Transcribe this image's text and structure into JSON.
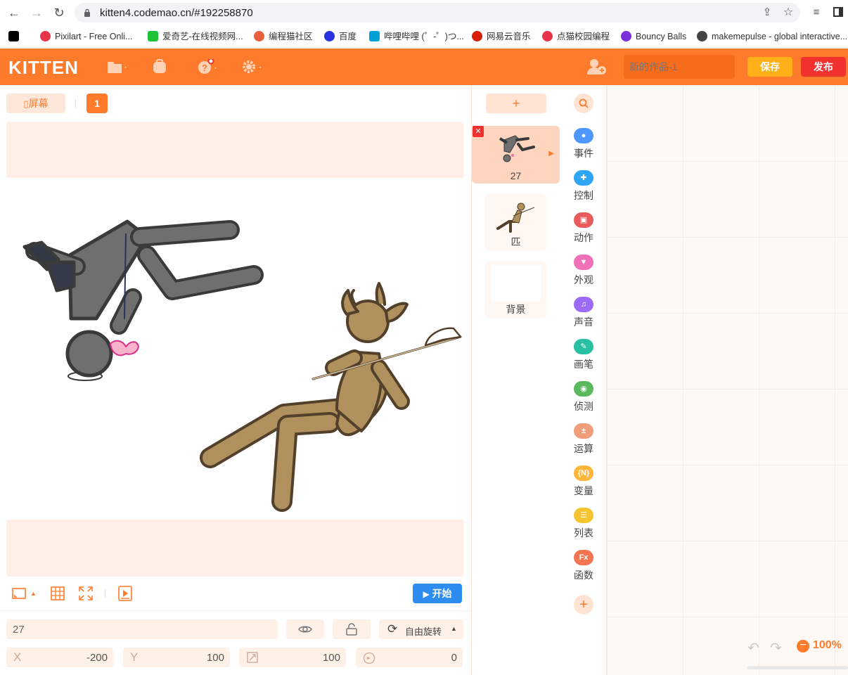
{
  "browser": {
    "url": "kitten4.codemao.cn/#192258870",
    "bookmarks": [
      {
        "label": "",
        "color": "#000000"
      },
      {
        "label": "Pixilart - Free Onli...",
        "color": "#e8334a"
      },
      {
        "label": "爱奇艺-在线视频网...",
        "color": "#1fc338"
      },
      {
        "label": "编程猫社区",
        "color": "#e8603c"
      },
      {
        "label": "百度",
        "color": "#2932e1"
      },
      {
        "label": "哔哩哔哩 (゜-゜)つ...",
        "color": "#00a1d6"
      },
      {
        "label": "网易云音乐",
        "color": "#d81e06"
      },
      {
        "label": "点猫校园编程",
        "color": "#e8334a"
      },
      {
        "label": "Bouncy Balls",
        "color": "#7b2fd8"
      },
      {
        "label": "makemepulse - global interactive...",
        "color": "#444444"
      }
    ]
  },
  "header": {
    "logo": "KITTEN",
    "title_placeholder": "新的作品-1",
    "save_label": "保存",
    "publish_label": "发布"
  },
  "stage": {
    "screen_label": "屏幕",
    "screen_number": "1",
    "start_label": "开始"
  },
  "sprite_props": {
    "name": "27",
    "rotation_label": "自由旋转",
    "x_label": "X",
    "x_value": "-200",
    "y_label": "Y",
    "y_value": "100",
    "size_value": "100",
    "direction_value": "0"
  },
  "sprites": {
    "add_label": "+",
    "items": [
      {
        "name": "27"
      },
      {
        "name": "匹"
      },
      {
        "name": "背景"
      }
    ]
  },
  "categories": [
    {
      "label": "事件",
      "color": "#4d97ff"
    },
    {
      "label": "控制",
      "color": "#2fa5f5"
    },
    {
      "label": "动作",
      "color": "#e85b5b"
    },
    {
      "label": "外观",
      "color": "#f070b8"
    },
    {
      "label": "声音",
      "color": "#9b6af6"
    },
    {
      "label": "画笔",
      "color": "#27c0a0"
    },
    {
      "label": "侦测",
      "color": "#5cb85c"
    },
    {
      "label": "运算",
      "color": "#f09e7a"
    },
    {
      "label": "变量",
      "color": "#ffb53a"
    },
    {
      "label": "列表",
      "color": "#f5c431"
    },
    {
      "label": "函数",
      "color": "#f37450"
    }
  ],
  "workspace": {
    "zoom": "100%"
  },
  "colors": {
    "brand": "#fe7b2c",
    "save": "#ffb019",
    "publish": "#f0312e",
    "start": "#2d8cf0"
  }
}
